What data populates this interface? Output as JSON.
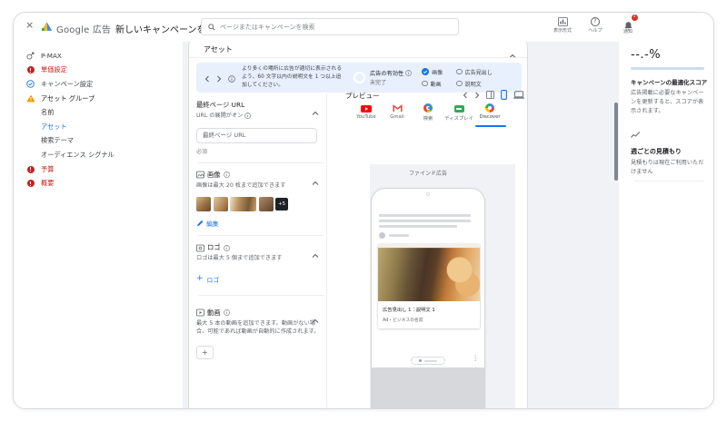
{
  "icons": {
    "close": "×",
    "question": "?",
    "overflow": "⋮",
    "add": "+"
  },
  "colors": {
    "accent": "#1a73e8",
    "error": "#c5221f",
    "warning": "#f29900",
    "notice_bg": "#e8f0fe"
  },
  "topbar": {
    "brand": "Google 広告",
    "title": "新しいキャンペーンを作成",
    "search_placeholder": "ページまたはキャンペーンを検索",
    "actions": [
      {
        "label": "表示形式"
      },
      {
        "label": "ヘルプ"
      },
      {
        "label": "通知",
        "badge": "1"
      }
    ]
  },
  "sidebar": {
    "items": [
      {
        "label": "P-MAX",
        "state": "default"
      },
      {
        "label": "単価設定",
        "state": "error"
      },
      {
        "label": "キャンペーン設定",
        "state": "done"
      },
      {
        "label": "アセット グループ",
        "state": "warning"
      },
      {
        "label": "名前",
        "state": "sub"
      },
      {
        "label": "アセット",
        "state": "sub-active"
      },
      {
        "label": "検索テーマ",
        "state": "sub"
      },
      {
        "label": "オーディエンス シグナル",
        "state": "sub"
      },
      {
        "label": "予算",
        "state": "error"
      },
      {
        "label": "概要",
        "state": "error"
      }
    ]
  },
  "asset_panel": {
    "title": "アセット",
    "notice": {
      "text": "より多くの場所に広告が適切に表示されるよう、60 文字以内の説明文を 1 つ以上追加してください。",
      "effectiveness_label": "広告の有効性",
      "effectiveness_status": "未完了",
      "checks": [
        {
          "label": "画像",
          "checked": true
        },
        {
          "label": "動画",
          "checked": false
        },
        {
          "label": "広告見出し",
          "checked": false
        },
        {
          "label": "説明文",
          "checked": false
        }
      ]
    },
    "final_url": {
      "title": "最終ページ URL",
      "subtitle": "URL の展開がオン",
      "placeholder": "最終ページ URL",
      "required_label": "必須"
    },
    "images": {
      "title": "画像",
      "subtitle": "画像は最大 20 枚まで追加できます",
      "more_count": "+5",
      "edit_label": "編集"
    },
    "logo": {
      "title": "ロゴ",
      "subtitle": "ロゴは最大 5 個まで追加できます",
      "add_label": "ロゴ"
    },
    "video": {
      "title": "動画",
      "subtitle": "最大 5 本の動画を追加できます。動画がない場合、可能であれば動画が自動的に作成されます。"
    }
  },
  "preview": {
    "title": "プレビュー",
    "active_device": "mobile",
    "tabs": [
      {
        "label": "YouTube",
        "active": false
      },
      {
        "label": "Gmail",
        "active": false
      },
      {
        "label": "検索",
        "active": false
      },
      {
        "label": "ディスプレイ",
        "active": false
      },
      {
        "label": "Discover",
        "active": true
      }
    ],
    "format_label": "ファインド広告",
    "ad": {
      "headline": "広告見出し 1｜説明文 1",
      "advertiser": "Ad・ビジネスの名前"
    }
  },
  "score_panel": {
    "score": "--.-%",
    "title": "キャンペーンの最適化スコア",
    "description": "広告掲載に必要なキャンペーンを更新すると、スコアが表示されます。",
    "weekly_title": "週ごとの見積もり",
    "weekly_description": "見積もりは現在ご利用いただけません"
  }
}
